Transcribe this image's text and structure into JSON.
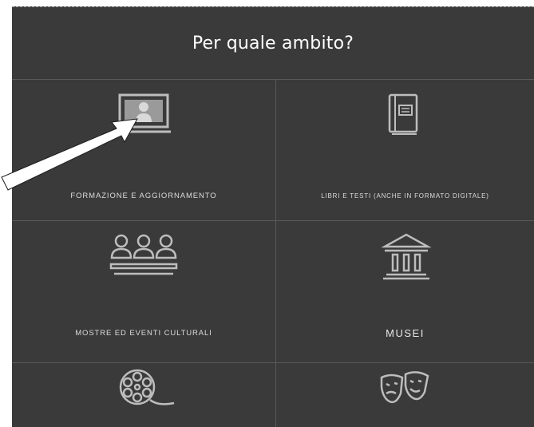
{
  "header": {
    "title": "Per quale ambito?"
  },
  "categories": [
    {
      "label": "FORMAZIONE E AGGIORNAMENTO",
      "icon": "presentation-screen-icon"
    },
    {
      "label": "LIBRI E TESTI (ANCHE IN FORMATO DIGITALE)",
      "icon": "book-icon"
    },
    {
      "label": "MOSTRE ED EVENTI CULTURALI",
      "icon": "audience-icon"
    },
    {
      "label": "MUSEI",
      "icon": "museum-icon"
    },
    {
      "label": "",
      "icon": "film-reel-icon"
    },
    {
      "label": "",
      "icon": "theater-masks-icon"
    }
  ],
  "colors": {
    "panel": "#3a3a3a",
    "divider": "#5a5a5a",
    "icon": "#bdbdbd",
    "arrow_fill": "#ffffff"
  }
}
